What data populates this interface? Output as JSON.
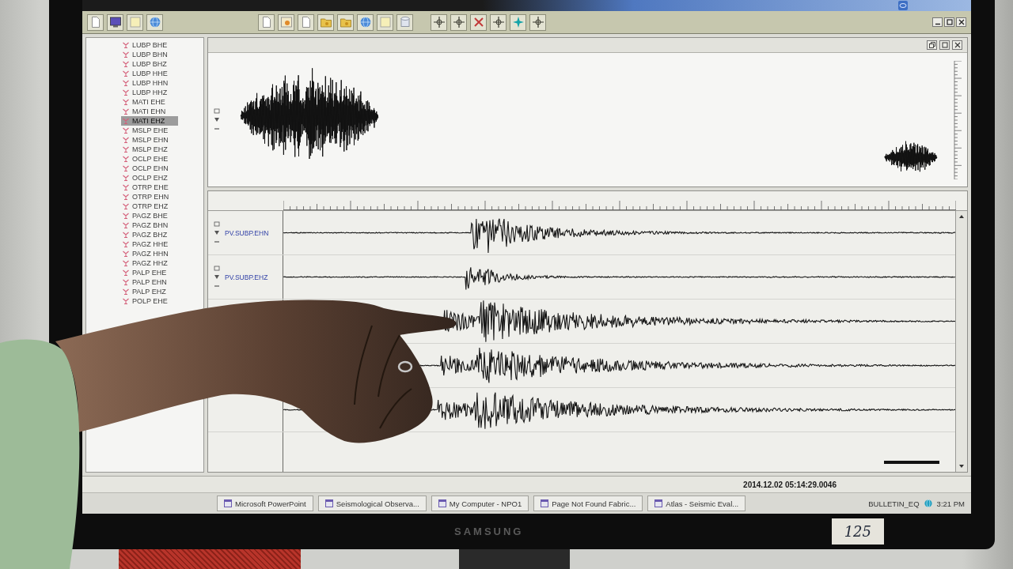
{
  "sidebar": {
    "items": [
      {
        "label": "LUBP BHE",
        "selected": false
      },
      {
        "label": "LUBP BHN",
        "selected": false
      },
      {
        "label": "LUBP BHZ",
        "selected": false
      },
      {
        "label": "LUBP HHE",
        "selected": false
      },
      {
        "label": "LUBP HHN",
        "selected": false
      },
      {
        "label": "LUBP HHZ",
        "selected": false
      },
      {
        "label": "MATI EHE",
        "selected": false
      },
      {
        "label": "MATI EHN",
        "selected": false
      },
      {
        "label": "MATI EHZ",
        "selected": true
      },
      {
        "label": "MSLP EHE",
        "selected": false
      },
      {
        "label": "MSLP EHN",
        "selected": false
      },
      {
        "label": "MSLP EHZ",
        "selected": false
      },
      {
        "label": "OCLP EHE",
        "selected": false
      },
      {
        "label": "OCLP EHN",
        "selected": false
      },
      {
        "label": "OCLP EHZ",
        "selected": false
      },
      {
        "label": "OTRP EHE",
        "selected": false
      },
      {
        "label": "OTRP EHN",
        "selected": false
      },
      {
        "label": "OTRP EHZ",
        "selected": false
      },
      {
        "label": "PAGZ BHE",
        "selected": false
      },
      {
        "label": "PAGZ BHN",
        "selected": false
      },
      {
        "label": "PAGZ BHZ",
        "selected": false
      },
      {
        "label": "PAGZ HHE",
        "selected": false
      },
      {
        "label": "PAGZ HHN",
        "selected": false
      },
      {
        "label": "PAGZ HHZ",
        "selected": false
      },
      {
        "label": "PALP EHE",
        "selected": false
      },
      {
        "label": "PALP EHN",
        "selected": false
      },
      {
        "label": "PALP EHZ",
        "selected": false
      },
      {
        "label": "POLP EHE",
        "selected": false
      }
    ]
  },
  "trace_labels": [
    "PV.SUBP.EHN",
    "PV.SUBP.EHZ"
  ],
  "status_bar": {
    "timestamp": "2014.12.02 05:14:29.0046"
  },
  "taskbar": {
    "items": [
      {
        "label": "Microsoft PowerPoint"
      },
      {
        "label": "Seismological Observa..."
      },
      {
        "label": "My Computer - NPO1"
      },
      {
        "label": "Page Not Found Fabric..."
      },
      {
        "label": "Atlas - Seismic Eval..."
      }
    ],
    "tray": {
      "label": "BULLETIN_EQ",
      "clock": "3:21 PM"
    }
  },
  "monitor": {
    "brand": "SAMSUNG",
    "sticker": "125"
  }
}
